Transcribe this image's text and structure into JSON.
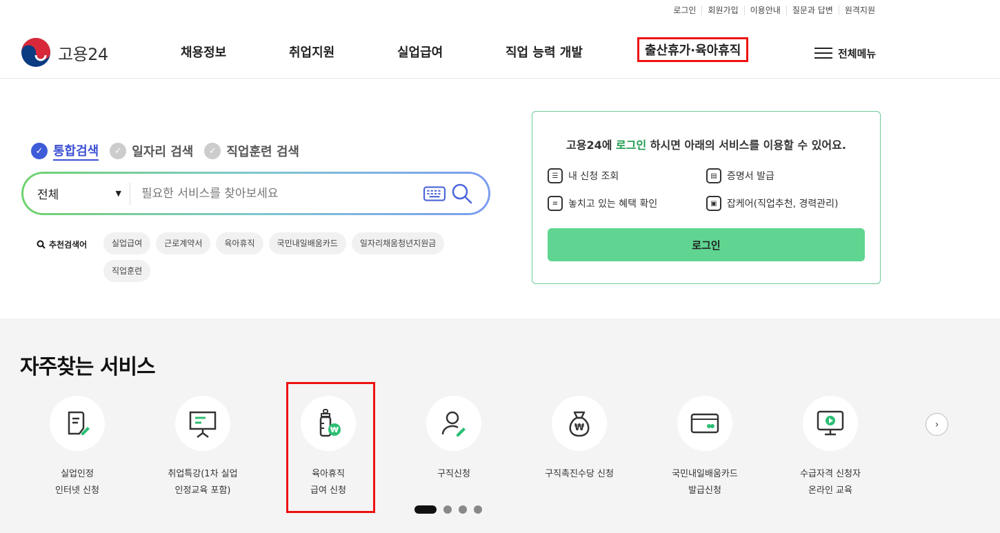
{
  "util_links": [
    "로그인",
    "회원가입",
    "이용안내",
    "질문과 답변",
    "원격지원"
  ],
  "logo_text": "고용24",
  "nav": [
    "채용정보",
    "취업지원",
    "실업급여",
    "직업 능력 개발",
    "출산휴가·육아휴직"
  ],
  "all_menu": "전체메뉴",
  "search_tabs": [
    "통합검색",
    "일자리 검색",
    "직업훈련 검색"
  ],
  "search": {
    "select": "전체",
    "placeholder": "필요한 서비스를 찾아보세요"
  },
  "recommended": {
    "label": "추천검색어",
    "chips": [
      "실업급여",
      "근로계약서",
      "육아휴직",
      "국민내일배움카드",
      "일자리채움청년지원금",
      "직업훈련"
    ]
  },
  "login_box": {
    "title_pre": "고용24에 ",
    "title_link": "로그인",
    "title_post": " 하시면 아래의 서비스를 이용할 수 있어요.",
    "services": [
      "내 신청 조회",
      "증명서 발급",
      "놓치고 있는 혜택 확인",
      "잡케어(직업추천, 경력관리)"
    ],
    "button": "로그인"
  },
  "frequent": {
    "title": "자주찾는 서비스",
    "items": [
      "실업인정\n인터넷 신청",
      "취업특강(1차 실업\n인정교육 포함)",
      "육아휴직\n급여 신청",
      "구직신청",
      "구직촉진수당 신청",
      "국민내일배움카드\n발급신청",
      "수급자격 신청자\n온라인 교육"
    ]
  },
  "colors": {
    "accent_blue": "#3e5bd8",
    "green": "#5fd591",
    "highlight_red": "#e11111"
  }
}
